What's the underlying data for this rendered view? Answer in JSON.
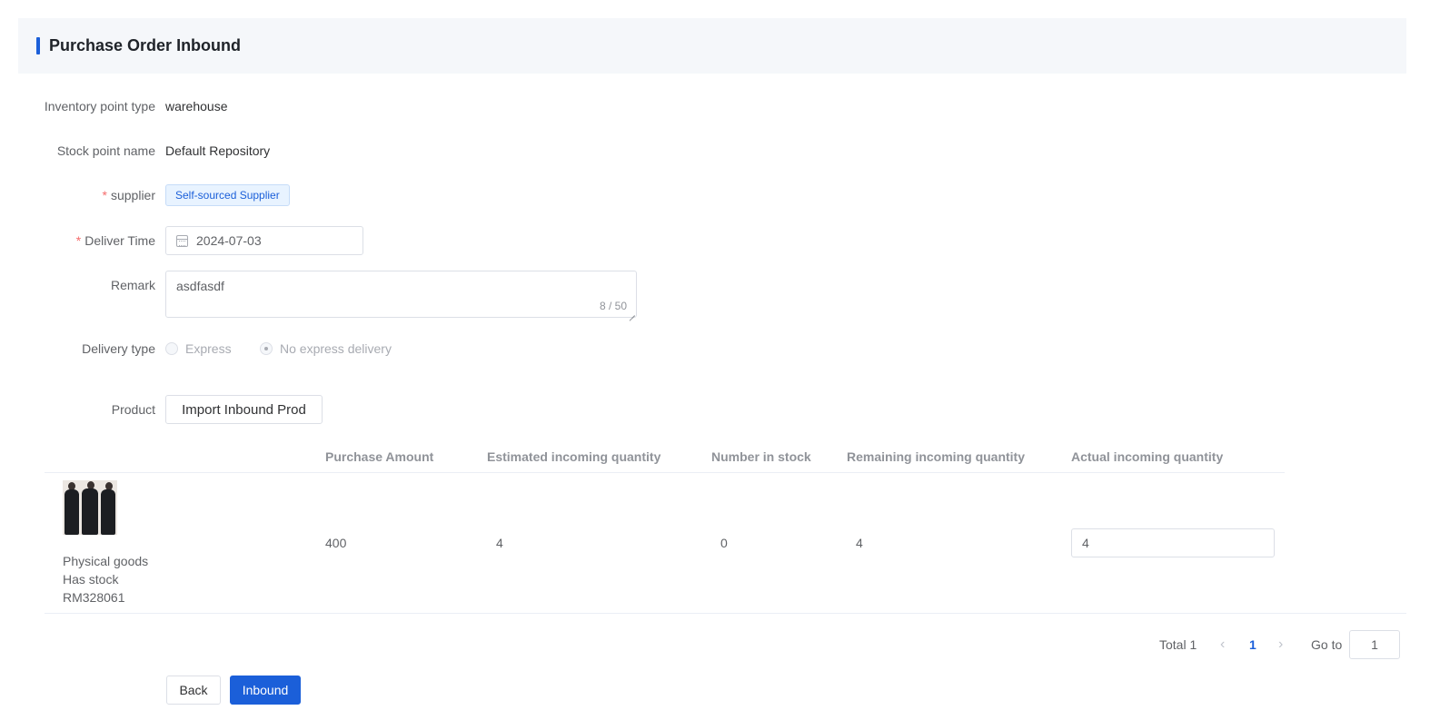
{
  "header": {
    "title": "Purchase Order Inbound"
  },
  "form": {
    "inventory_point_type": {
      "label": "Inventory point type",
      "value": "warehouse"
    },
    "stock_point_name": {
      "label": "Stock point name",
      "value": "Default Repository"
    },
    "supplier": {
      "label": "supplier",
      "required_mark": "*",
      "tag": "Self-sourced Supplier"
    },
    "deliver_time": {
      "label": "Deliver Time",
      "required_mark": "*",
      "value": "2024-07-03",
      "icon": "calendar-icon"
    },
    "remark": {
      "label": "Remark",
      "value": "asdfasdf",
      "counter": "8 / 50"
    },
    "delivery_type": {
      "label": "Delivery type",
      "options": [
        {
          "label": "Express",
          "checked": false
        },
        {
          "label": "No express delivery",
          "checked": true
        }
      ],
      "disabled": true
    },
    "product": {
      "label": "Product",
      "import_button": "Import Inbound Prod"
    }
  },
  "table": {
    "columns": [
      "",
      "Purchase Amount",
      "Estimated incoming quantity",
      "Number in stock",
      "Remaining incoming quantity",
      "Actual incoming quantity"
    ],
    "rows": [
      {
        "product_lines": [
          "Physical goods",
          "Has stock",
          "RM328061"
        ],
        "purchase_amount": "400",
        "estimated_incoming": "4",
        "number_in_stock": "0",
        "remaining_incoming": "4",
        "actual_incoming": "4"
      }
    ]
  },
  "pagination": {
    "total_text": "Total 1",
    "current_page": "1",
    "goto_label": "Go to",
    "goto_value": "1",
    "prev_icon": "chevron-left-icon",
    "next_icon": "chevron-right-icon"
  },
  "actions": {
    "back": "Back",
    "inbound": "Inbound"
  },
  "colors": {
    "primary": "#1b5fd9",
    "required": "#f56c6c",
    "tag_bg": "#e8f3ff"
  }
}
